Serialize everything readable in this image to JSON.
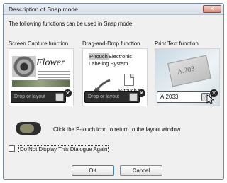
{
  "window": {
    "title": "Description of Snap mode",
    "close_glyph": "✕"
  },
  "intro_text": "The following functions can be used in Snap mode.",
  "functions": [
    {
      "label": "Screen Capture function",
      "drop_bar_text": "Drop or layout"
    },
    {
      "label": "Drag-and-Drop function",
      "drop_bar_text": "Drop or layout",
      "sample_text_selected": "P-touch",
      "sample_text_rest": "Electronic",
      "sample_text_line2": "Labeling System",
      "file_name": "P-touch.txt"
    },
    {
      "label": "Print Text function",
      "input_value": "A.2033",
      "tape_text": "A.203"
    }
  ],
  "screen_capture_sample": {
    "heading": "Flower"
  },
  "hint_text": "Click the P-touch icon to return to the layout window.",
  "checkbox": {
    "label": "Do Not Display This Dialogue Again",
    "checked": false
  },
  "buttons": {
    "ok": "OK",
    "cancel": "Cancel"
  },
  "icons": {
    "close_circle": "✕"
  },
  "colors": {
    "dropbar": "#2c2c2c",
    "title_close": "#d98a7c"
  }
}
